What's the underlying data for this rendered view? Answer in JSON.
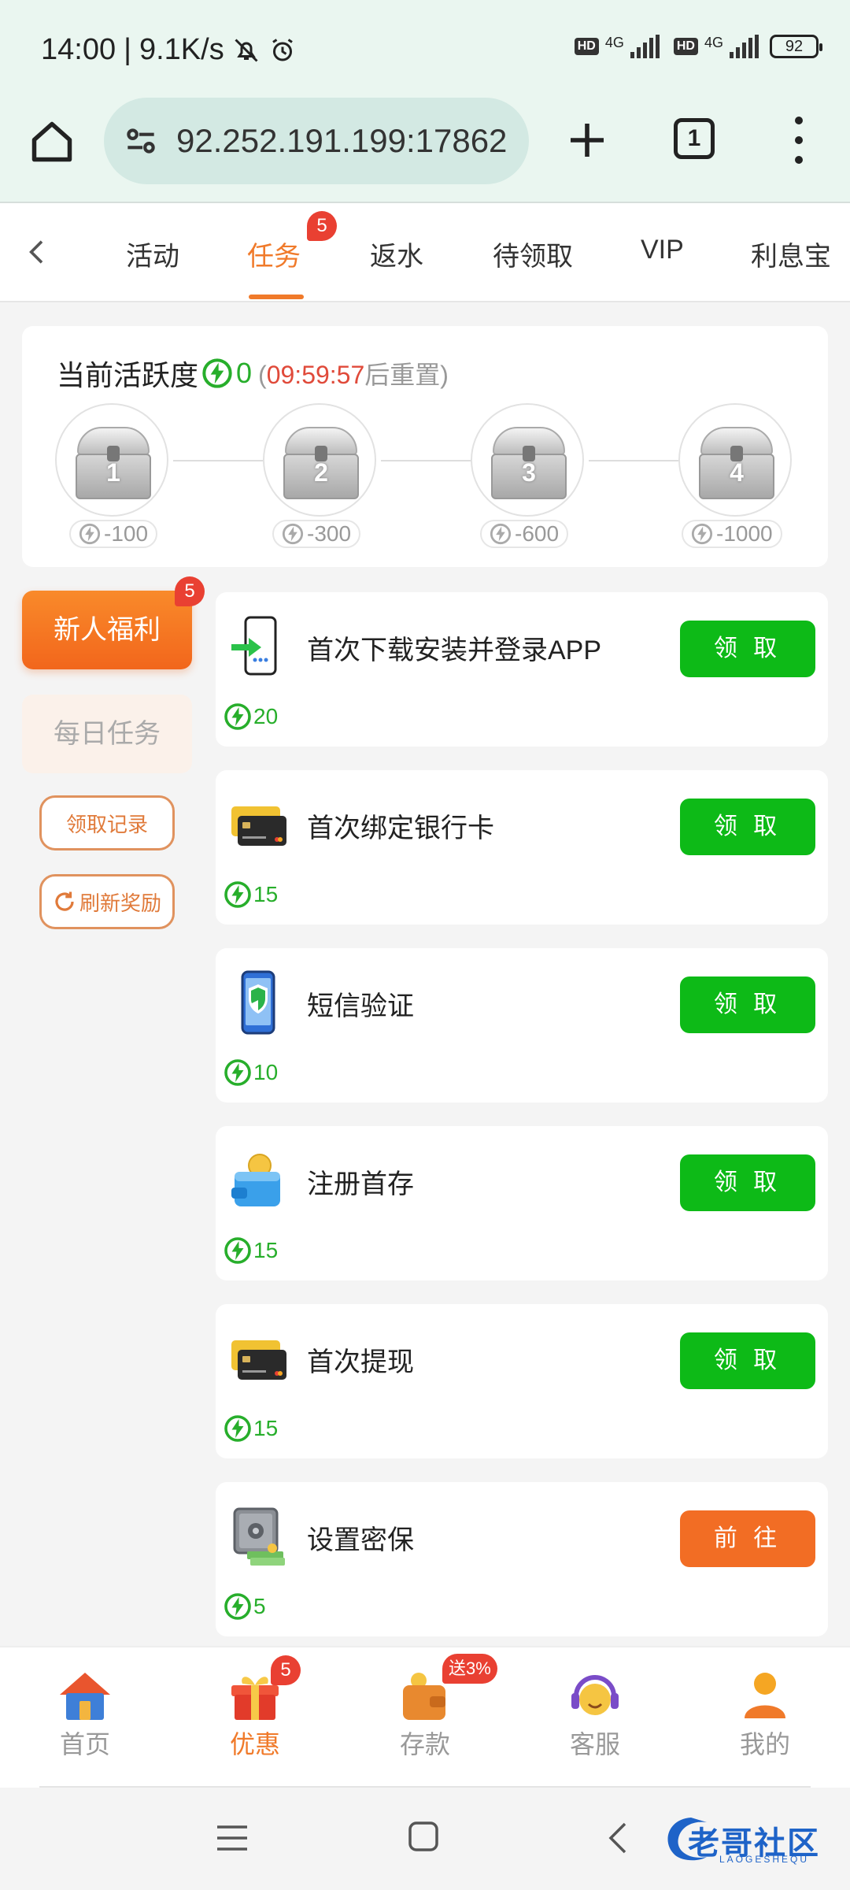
{
  "status_bar": {
    "time": "14:00",
    "net_speed": "9.1K/s",
    "hd1": "HD",
    "net1": "4G",
    "hd2": "HD",
    "net2": "4G",
    "battery": "92"
  },
  "browser": {
    "url": "92.252.191.199:17862",
    "tab_count": "1"
  },
  "tabs": {
    "items": [
      "活动",
      "任务",
      "返水",
      "待领取",
      "VIP",
      "利息宝"
    ],
    "active_index": 1,
    "task_badge": "5"
  },
  "activity": {
    "title": "当前活跃度",
    "value": "0",
    "reset_open": "(",
    "reset_time": "09:59:57",
    "reset_suffix": "后重置)",
    "chests": [
      {
        "num": "1",
        "points": "-100"
      },
      {
        "num": "2",
        "points": "-300"
      },
      {
        "num": "3",
        "points": "-600"
      },
      {
        "num": "4",
        "points": "-1000"
      }
    ]
  },
  "sidebar": {
    "newbie": "新人福利",
    "newbie_badge": "5",
    "daily": "每日任务",
    "record": "领取记录",
    "refresh": "刷新奖励"
  },
  "tasks": [
    {
      "name": "首次下载安装并登录APP",
      "reward": "20",
      "button": "领 取",
      "icon": "app-download-icon"
    },
    {
      "name": "首次绑定银行卡",
      "reward": "15",
      "button": "领 取",
      "icon": "bank-card-icon"
    },
    {
      "name": "短信验证",
      "reward": "10",
      "button": "领 取",
      "icon": "phone-shield-icon"
    },
    {
      "name": "注册首存",
      "reward": "15",
      "button": "领 取",
      "icon": "wallet-icon"
    },
    {
      "name": "首次提现",
      "reward": "15",
      "button": "领 取",
      "icon": "bank-card-icon"
    },
    {
      "name": "设置密保",
      "reward": "5",
      "button": "前 往",
      "icon": "safe-icon"
    }
  ],
  "bottom_nav": {
    "items": [
      "首页",
      "优惠",
      "存款",
      "客服",
      "我的"
    ],
    "active_index": 1,
    "promo_badge": "5",
    "deposit_badge": "送3%"
  },
  "watermark": {
    "text": "老哥社区",
    "sub": "LAOGESHEQU"
  },
  "colors": {
    "accent": "#f07a2a",
    "green": "#0dba17",
    "reward_green": "#27ae2b",
    "timer_red": "#e04a3a",
    "badge_red": "#e94032"
  }
}
